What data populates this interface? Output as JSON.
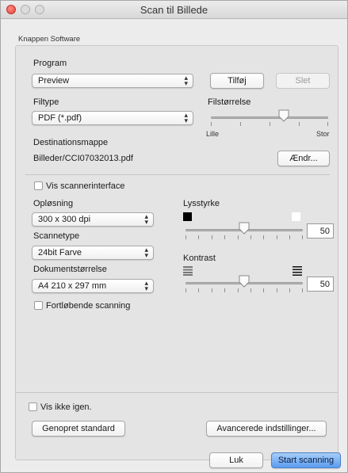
{
  "window": {
    "title": "Scan til Billede"
  },
  "group": {
    "label": "Knappen Software"
  },
  "program": {
    "label": "Program",
    "selected": "Preview",
    "add_label": "Tilføj",
    "delete_label": "Slet"
  },
  "filetype": {
    "label": "Filtype",
    "selected": "PDF (*.pdf)"
  },
  "filesize": {
    "label": "Filstørrelse",
    "min_label": "Lille",
    "max_label": "Stor",
    "value_fraction": 0.62
  },
  "destination": {
    "label": "Destinationsmappe",
    "path": "Billeder/CCI07032013.pdf",
    "change_label": "Ændr..."
  },
  "scanner_interface": {
    "label": "Vis scannerinterface",
    "checked": false
  },
  "resolution": {
    "label": "Opløsning",
    "selected": "300 x 300 dpi"
  },
  "scan_type": {
    "label": "Scannetype",
    "selected": "24bit Farve"
  },
  "document_size": {
    "label": "Dokumentstørrelse",
    "selected": "A4 210 x 297 mm"
  },
  "continuous_scan": {
    "label": "Fortløbende scanning",
    "checked": false
  },
  "brightness": {
    "label": "Lysstyrke",
    "value": "50"
  },
  "contrast": {
    "label": "Kontrast",
    "value": "50"
  },
  "footer": {
    "dont_show_label": "Vis ikke igen.",
    "restore_label": "Genopret standard",
    "advanced_label": "Avancerede indstillinger...",
    "close_label": "Luk",
    "start_label": "Start scanning"
  },
  "colors": {
    "primary_button": "#5a9cf0",
    "close_dot": "#e0443e"
  },
  "icons": [
    "close-dot-icon",
    "minimize-dot-icon",
    "zoom-dot-icon",
    "popup-arrows-icon",
    "slider-thumb-icon",
    "black-square-icon",
    "white-square-icon",
    "contrast-low-icon",
    "contrast-high-icon"
  ]
}
